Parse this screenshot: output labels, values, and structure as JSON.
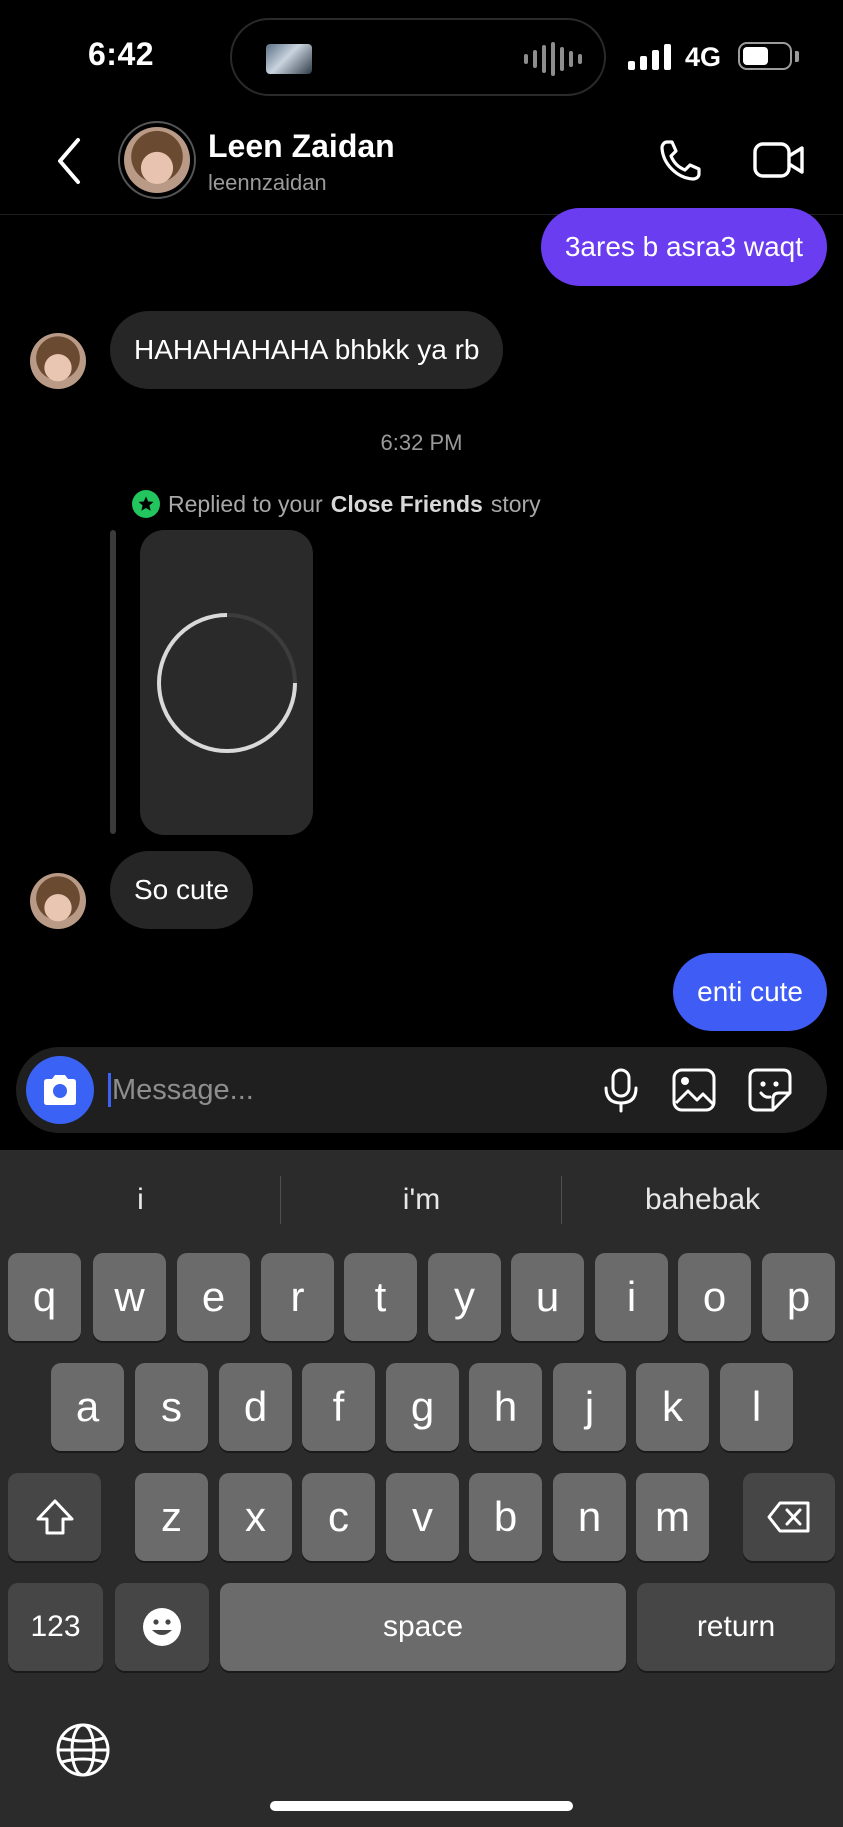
{
  "status_bar": {
    "time": "6:42",
    "network": "4G"
  },
  "header": {
    "name": "Leen Zaidan",
    "username": "leennzaidan"
  },
  "messages": {
    "sent_1": "3ares b asra3 waqt",
    "received_1": "HAHAHAHAHA bhbkk ya rb",
    "timestamp": "6:32 PM",
    "reply_prefix": "Replied to your",
    "reply_highlight": "Close Friends",
    "reply_suffix": "story",
    "received_2": "So cute",
    "sent_2": "enti cute"
  },
  "composer": {
    "placeholder": "Message..."
  },
  "keyboard": {
    "suggestions": [
      "i",
      "i'm",
      "bahebak"
    ],
    "row1": [
      "q",
      "w",
      "e",
      "r",
      "t",
      "y",
      "u",
      "i",
      "o",
      "p"
    ],
    "row2": [
      "a",
      "s",
      "d",
      "f",
      "g",
      "h",
      "j",
      "k",
      "l"
    ],
    "row3": [
      "z",
      "x",
      "c",
      "v",
      "b",
      "n",
      "m"
    ],
    "numbers_label": "123",
    "space_label": "space",
    "return_label": "return"
  },
  "colors": {
    "sent_purple": "#6b3df0",
    "sent_blue": "#3f5cf4",
    "camera_blue": "#3a62f5",
    "close_friends_green": "#22c55e"
  }
}
